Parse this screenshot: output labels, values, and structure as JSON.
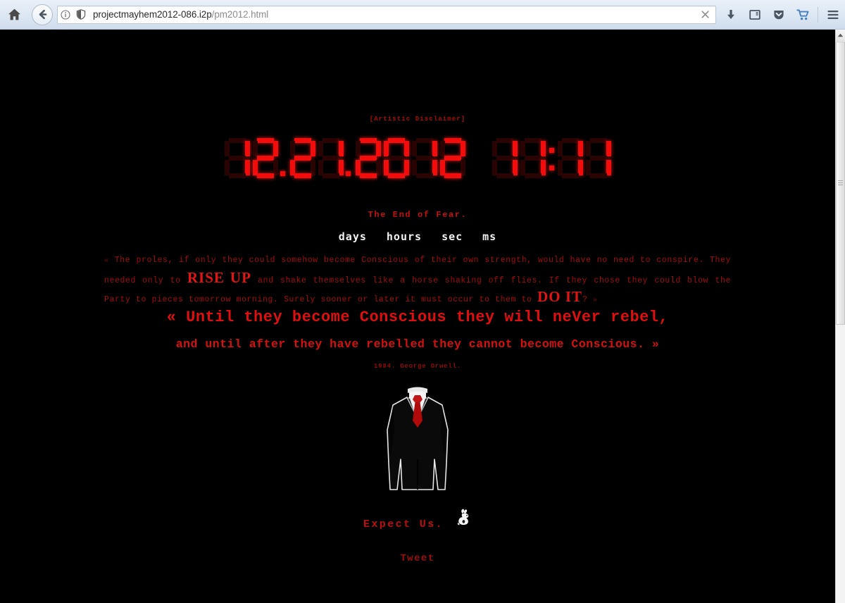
{
  "browser": {
    "home_icon": "home-icon",
    "back_icon": "back-arrow-icon",
    "identity_icon": "info-circle-icon",
    "tracking_icon": "shield-icon",
    "url_display": "projectmayhem2012-086.i2p",
    "url_path": "/pm2012.html",
    "url_full": "projectmayhem2012-086.i2p/pm2012.html",
    "clear_icon": "close-x-icon",
    "toolbar_buttons": [
      {
        "name": "downloads-button",
        "icon": "download-arrow-icon"
      },
      {
        "name": "reader-view-button",
        "icon": "window-panel-icon"
      },
      {
        "name": "pocket-button",
        "icon": "pocket-shield-icon"
      },
      {
        "name": "cart-button",
        "icon": "shopping-cart-icon"
      },
      {
        "name": "menu-button",
        "icon": "hamburger-menu-icon"
      }
    ]
  },
  "page": {
    "disclaimer": "[Artistic Disclaimer]",
    "clock": {
      "date_digits": [
        "1",
        "2",
        ".",
        "2",
        "1",
        ".",
        "2",
        "0",
        "1",
        "2"
      ],
      "time_digits": [
        "1",
        "1",
        ":",
        "1",
        "1"
      ],
      "date_display": "12.21.2012",
      "time_display": "11:11"
    },
    "tagline": "The End of Fear.",
    "units": [
      "days",
      "hours",
      "sec",
      "ms"
    ],
    "paragraph": {
      "open_guillemet": "«",
      "part1": " The proles, if only they could somehow become Conscious of their own strength, would have no need to conspire. They needed only to ",
      "emph1": "RISE UP",
      "part2": " and shake themselves like a horse shaking off flies. If they chose they could blow the Party to pieces tomorrow morning. Surely sooner or later it must occur to them to ",
      "emph2": "DO IT",
      "part3": "? ",
      "close_guillemet": "»"
    },
    "quote_line1": "« Until they become Conscious they will neVer rebel,",
    "quote_line2": "and until after they have rebelled they cannot become Conscious. »",
    "attribution": "1984. George Orwell.",
    "figure_alt": "anonymous-suit-figure",
    "expect_text": "Expect Us.",
    "rabbit_alt": "white-rabbit-icon",
    "tweet_label": "Tweet"
  },
  "colors": {
    "background": "#000000",
    "led_on": "#f20c0c",
    "led_off": "#2a0303",
    "text_red": "#a00c0c",
    "bright_red": "#e21414",
    "tie_red": "#b00a0a",
    "white": "#f2f2f2",
    "chrome": "#dce7f3"
  },
  "scroll": {
    "position_percent": 0
  }
}
